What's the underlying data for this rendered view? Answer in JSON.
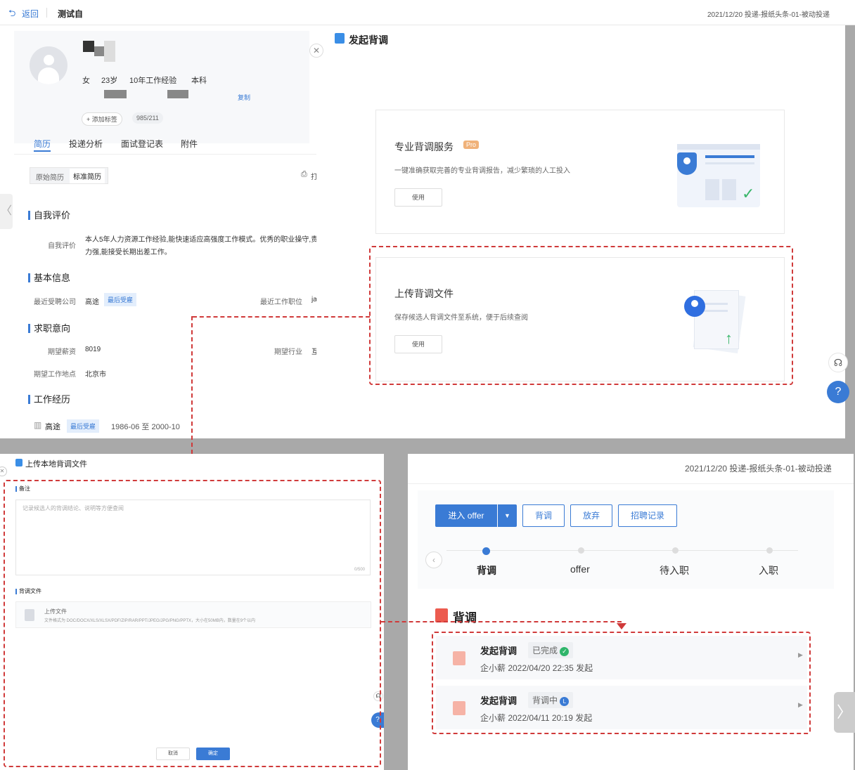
{
  "topbar": {
    "back": "返回",
    "name": "测试自",
    "job_info": "2021/12/20 投递-报纸头条-01-被动投递"
  },
  "profile": {
    "gender": "女",
    "age": "23岁",
    "experience": "10年工作经验",
    "education": "本科",
    "copy": "复制",
    "add_tag": "+ 添加标签",
    "school_tag": "985/211"
  },
  "tabs": [
    "简历",
    "投递分析",
    "面试登记表",
    "附件"
  ],
  "resume_toggle": {
    "original": "原始简历",
    "standard": "标准简历"
  },
  "print_icon_label": "打",
  "self_eval": {
    "title": "自我评价",
    "label": "自我评价",
    "text_line1": "本人5年人力资源工作经验,能快速适应高强度工作模式。优秀的职业操守,责",
    "text_line2": "力强,能接受长期出差工作。"
  },
  "basic": {
    "title": "基本信息",
    "recent_company_label": "最近受聘公司",
    "recent_company": "高途",
    "recent_badge": "最后受雇",
    "recent_position_label": "最近工作职位",
    "recent_position": "ja"
  },
  "intent": {
    "title": "求职意向",
    "salary_label": "期望薪资",
    "salary": "8019",
    "industry_label": "期望行业",
    "industry": "互",
    "city_label": "期望工作地点",
    "city": "北京市"
  },
  "work": {
    "title": "工作经历",
    "company": "高途",
    "badge": "最后受雇",
    "period": "1986-06 至 2000-10"
  },
  "bgcheck": {
    "title": "发起背调",
    "pro": {
      "title": "专业背调服务",
      "pro_badge": "Pro",
      "desc": "一键准确获取完善的专业背调报告，减少繁琐的人工投入",
      "btn": "使用"
    },
    "upload": {
      "title": "上传背调文件",
      "desc": "保存候选人背调文件至系统，便于后续查阅",
      "btn": "使用"
    }
  },
  "upload_dialog": {
    "title": "上传本地背调文件",
    "note_label": "备注",
    "note_placeholder": "记录候选人的背调结论、说明等方便查阅",
    "note_count": "0/500",
    "file_label": "背调文件",
    "file_title": "上传文件",
    "file_hint": "文件格式为 DOC/DOCX/XLS/XLSX/PDF/ZIP/RAR/PPT/JPEG/JPG/PNG/PPTX，大小在50MB内，数量在9个以内",
    "cancel": "取消",
    "confirm": "确定"
  },
  "pipeline": {
    "job_info": "2021/12/20 投递-报纸头条-01-被动投递",
    "buttons": {
      "offer": "进入 offer",
      "bg": "背调",
      "abandon": "放弃",
      "records": "招聘记录"
    },
    "steps": [
      "背调",
      "offer",
      "待入职",
      "入职"
    ],
    "section_title": "背调",
    "records": [
      {
        "title": "发起背调",
        "status": "已完成",
        "meta": "企小薪 2022/04/20 22:35 发起",
        "status_color": "#2fb56a"
      },
      {
        "title": "发起背调",
        "status": "背调中",
        "meta": "企小薪 2022/04/11 20:19 发起",
        "status_color": "#3a7bd5"
      }
    ]
  }
}
